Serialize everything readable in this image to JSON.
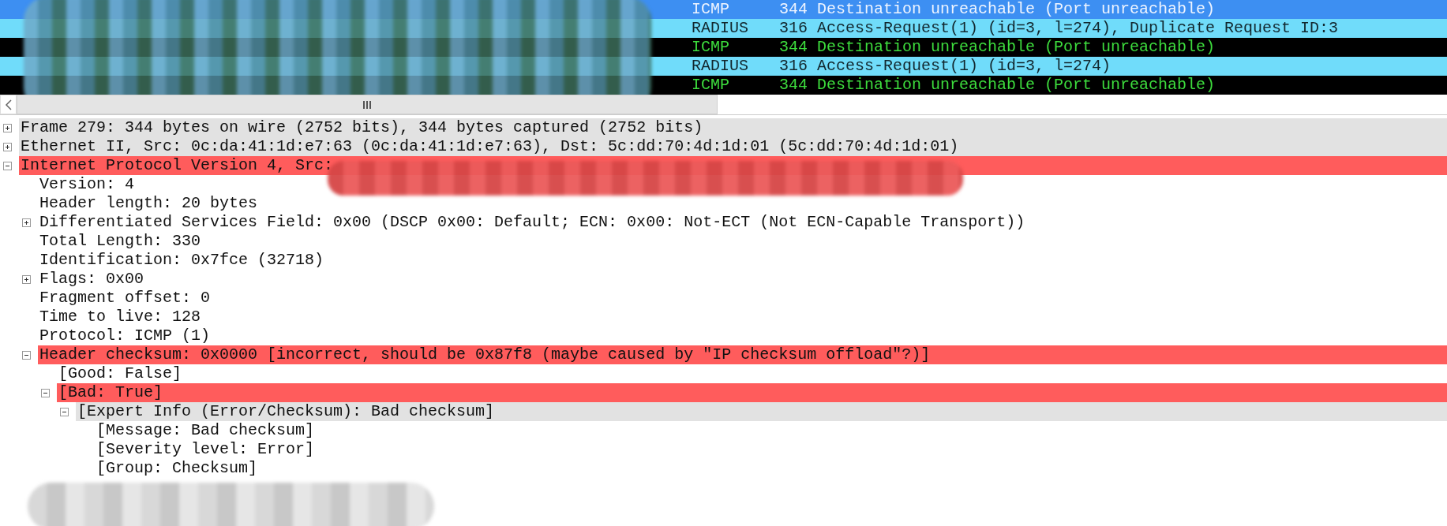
{
  "packet_list": {
    "rows": [
      {
        "protocol": "ICMP",
        "length": "344",
        "info": "Destination unreachable (Port unreachable)",
        "selected": true
      },
      {
        "protocol": "RADIUS",
        "length": "316",
        "info": "Access-Request(1) (id=3, l=274), Duplicate Request ID:3",
        "selected": false,
        "kind": "radius"
      },
      {
        "protocol": "ICMP",
        "length": "344",
        "info": "Destination unreachable (Port unreachable)",
        "selected": false,
        "kind": "icmp"
      },
      {
        "protocol": "RADIUS",
        "length": "316",
        "info": "Access-Request(1) (id=3, l=274)",
        "selected": false,
        "kind": "radius"
      },
      {
        "protocol": "ICMP",
        "length": "344",
        "info": "Destination unreachable (Port unreachable)",
        "selected": false,
        "kind": "icmp"
      }
    ]
  },
  "details": {
    "nodes": [
      {
        "text": "Frame 279: 344 bytes on wire (2752 bits), 344 bytes captured (2752 bits)",
        "expanded": false,
        "color": "#e2e2e2"
      },
      {
        "text": "Ethernet II, Src: 0c:da:41:1d:e7:63 (0c:da:41:1d:e7:63), Dst: 5c:dd:70:4d:1d:01 (5c:dd:70:4d:1d:01)",
        "expanded": false,
        "color": "#e2e2e2"
      },
      {
        "text": "Internet Protocol Version 4, Src:",
        "expanded": true,
        "color": "#ff5c5c",
        "children": [
          {
            "text": "Version: 4"
          },
          {
            "text": "Header length: 20 bytes"
          },
          {
            "text": "Differentiated Services Field: 0x00 (DSCP 0x00: Default; ECN: 0x00: Not-ECT (Not ECN-Capable Transport))",
            "expanded": false
          },
          {
            "text": "Total Length: 330"
          },
          {
            "text": "Identification: 0x7fce (32718)"
          },
          {
            "text": "Flags: 0x00",
            "expanded": false
          },
          {
            "text": "Fragment offset: 0"
          },
          {
            "text": "Time to live: 128"
          },
          {
            "text": "Protocol: ICMP (1)"
          },
          {
            "text": "Header checksum: 0x0000 [incorrect, should be 0x87f8 (maybe caused by \"IP checksum offload\"?)]",
            "expanded": true,
            "color": "#ff5c5c",
            "children": [
              {
                "text": "[Good: False]"
              },
              {
                "text": "[Bad: True]",
                "expanded": true,
                "color": "#ff5c5c",
                "children": [
                  {
                    "text": "[Expert Info (Error/Checksum): Bad checksum]",
                    "expanded": true,
                    "color": "#e2e2e2",
                    "children": [
                      {
                        "text": "[Message: Bad checksum]"
                      },
                      {
                        "text": "[Severity level: Error]"
                      },
                      {
                        "text": "[Group: Checksum]"
                      }
                    ]
                  }
                ]
              }
            ]
          }
        ]
      }
    ]
  }
}
